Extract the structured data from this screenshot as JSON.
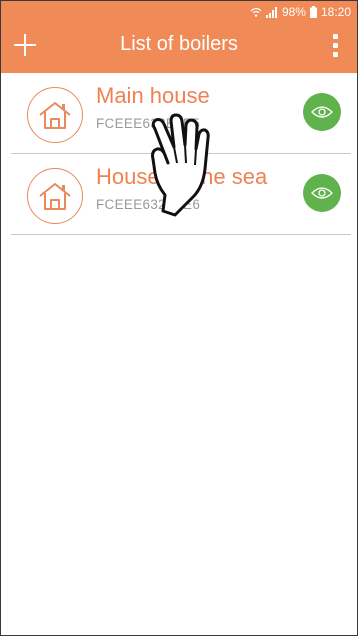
{
  "status_bar": {
    "battery": "98%",
    "time": "18:20",
    "icons": [
      "wifi-icon",
      "signal-icon",
      "battery-icon"
    ]
  },
  "app_bar": {
    "title": "List of boilers",
    "add_icon": "plus-icon",
    "menu_icon": "more-vertical-icon"
  },
  "boilers": [
    {
      "name": "Main house",
      "id": "FCEEE632B4E5",
      "icon": "house-icon",
      "action_icon": "eye-icon"
    },
    {
      "name": "House by the sea",
      "id": "FCEEE632B4E6",
      "icon": "house-icon",
      "action_icon": "eye-icon"
    }
  ],
  "colors": {
    "primary": "#f08a56",
    "accent_text": "#ee8253",
    "eye_button": "#5fb24c",
    "secondary_text": "#9a9a9a",
    "divider": "#c9c9c9"
  }
}
